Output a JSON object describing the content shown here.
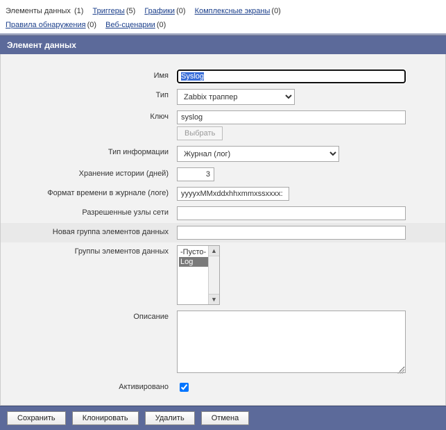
{
  "nav": {
    "items": [
      {
        "label": "Элементы данных",
        "count": "(1)",
        "current": true
      },
      {
        "label": "Триггеры",
        "count": "(5)"
      },
      {
        "label": "Графики",
        "count": "(0)"
      },
      {
        "label": "Комплексные экраны",
        "count": "(0)"
      },
      {
        "label": "Правила обнаружения",
        "count": "(0)"
      },
      {
        "label": "Веб-сценарии",
        "count": "(0)"
      }
    ]
  },
  "section": {
    "title": "Элемент данных"
  },
  "form": {
    "name": {
      "label": "Имя",
      "value": "Syslog"
    },
    "type": {
      "label": "Тип",
      "value": "Zabbix траппер"
    },
    "key": {
      "label": "Ключ",
      "value": "syslog",
      "select_btn": "Выбрать"
    },
    "info_type": {
      "label": "Тип информации",
      "value": "Журнал (лог)"
    },
    "history": {
      "label": "Хранение истории (дней)",
      "value": "3"
    },
    "time_format": {
      "label": "Формат времени в журнале (логе)",
      "value": "yyyyxMMxddxhhxmmxssxxxx:"
    },
    "allowed_hosts": {
      "label": "Разрешенные узлы сети",
      "value": ""
    },
    "new_group": {
      "label": "Новая группа элементов данных",
      "value": ""
    },
    "groups": {
      "label": "Группы элементов данных",
      "options": [
        {
          "label": "-Пусто-",
          "selected": false
        },
        {
          "label": "Log",
          "selected": true
        }
      ]
    },
    "description": {
      "label": "Описание",
      "value": ""
    },
    "enabled": {
      "label": "Активировано",
      "checked": true
    }
  },
  "buttons": {
    "save": "Сохранить",
    "clone": "Клонировать",
    "delete": "Удалить",
    "cancel": "Отмена"
  }
}
